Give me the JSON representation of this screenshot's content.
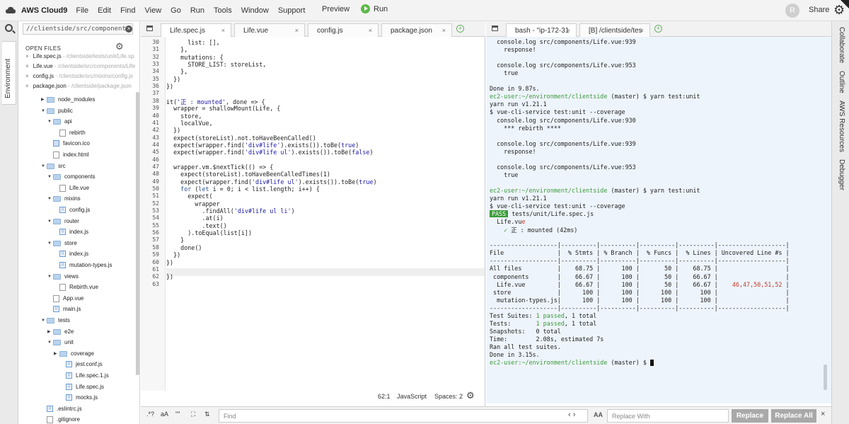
{
  "topbar": {
    "brand": "AWS Cloud9",
    "menus": [
      "File",
      "Edit",
      "Find",
      "View",
      "Go",
      "Run",
      "Tools",
      "Window",
      "Support"
    ],
    "preview_label": "Preview",
    "run_label": "Run",
    "avatar_letter": "R",
    "share_label": "Share"
  },
  "left_rail": {
    "environment_label": "Environment"
  },
  "file_panel": {
    "goto_value": "//clientside/src/components",
    "open_files_title": "OPEN FILES",
    "open_files": [
      {
        "name": "Life.spec.js",
        "path": " - /clientside/tests/unit/Life.sp"
      },
      {
        "name": "Life.vue",
        "path": " - /clientside/src/components/Life"
      },
      {
        "name": "config.js",
        "path": " - /clientside/src/mixins/config.js"
      },
      {
        "name": "package.json",
        "path": " - /clientside/package.json"
      }
    ],
    "tree": [
      {
        "label": "node_modules",
        "type": "folder",
        "arrow": "▶"
      },
      {
        "label": "public",
        "type": "folder",
        "arrow": "▼"
      },
      {
        "label": "api",
        "type": "folder",
        "arrow": "▼"
      },
      {
        "label": "rebirth",
        "type": "file",
        "arrow": ""
      },
      {
        "label": "favicon.ico",
        "type": "img",
        "arrow": ""
      },
      {
        "label": "index.html",
        "type": "file",
        "arrow": ""
      },
      {
        "label": "src",
        "type": "folder",
        "arrow": "▼"
      },
      {
        "label": "components",
        "type": "folder",
        "arrow": "▼"
      },
      {
        "label": "Life.vue",
        "type": "file",
        "arrow": ""
      },
      {
        "label": "mixins",
        "type": "folder",
        "arrow": "▼"
      },
      {
        "label": "config.js",
        "type": "js",
        "arrow": ""
      },
      {
        "label": "router",
        "type": "folder",
        "arrow": "▼"
      },
      {
        "label": "index.js",
        "type": "js",
        "arrow": ""
      },
      {
        "label": "store",
        "type": "folder",
        "arrow": "▼"
      },
      {
        "label": "index.js",
        "type": "js",
        "arrow": ""
      },
      {
        "label": "mutation-types.js",
        "type": "js",
        "arrow": ""
      },
      {
        "label": "views",
        "type": "folder",
        "arrow": "▼"
      },
      {
        "label": "Rebirth.vue",
        "type": "file",
        "arrow": ""
      },
      {
        "label": "App.vue",
        "type": "file",
        "arrow": ""
      },
      {
        "label": "main.js",
        "type": "js",
        "arrow": ""
      },
      {
        "label": "tests",
        "type": "folder",
        "arrow": "▼"
      },
      {
        "label": "e2e",
        "type": "folder",
        "arrow": "▶"
      },
      {
        "label": "unit",
        "type": "folder",
        "arrow": "▼"
      },
      {
        "label": "coverage",
        "type": "folder",
        "arrow": "▶"
      },
      {
        "label": "jest.conf.js",
        "type": "js",
        "arrow": ""
      },
      {
        "label": "Life.spec.1.js",
        "type": "js",
        "arrow": ""
      },
      {
        "label": "Life.spec.js",
        "type": "js",
        "arrow": ""
      },
      {
        "label": "mocks.js",
        "type": "js",
        "arrow": ""
      },
      {
        "label": ".eslintrc.js",
        "type": "js",
        "arrow": ""
      },
      {
        "label": ".gitignore",
        "type": "file",
        "arrow": ""
      }
    ]
  },
  "editor": {
    "tabs": [
      "Life.spec.js",
      "Life.vue",
      "config.js",
      "package.json"
    ],
    "line_numbers": [
      "30",
      "31",
      "32",
      "33",
      "34",
      "35",
      "36",
      "37",
      "38",
      "39",
      "40",
      "41",
      "42",
      "43",
      "44",
      "45",
      "46",
      "47",
      "48",
      "49",
      "50",
      "51",
      "52",
      "53",
      "54",
      "55",
      "56",
      "57",
      "58",
      "59",
      "60",
      "61",
      "62",
      "63"
    ],
    "code_lines": [
      "      list: [],",
      "    },",
      "    mutations: {",
      "      STORE_LIST: storeList,",
      "    },",
      "  })",
      "})",
      "",
      "it('正 : mounted', done => {",
      "  wrapper = shallowMount(Life, {",
      "    store,",
      "    localVue,",
      "  })",
      "  expect(storeList).not.toHaveBeenCalled()",
      "  expect(wrapper.find('div#life').exists()).toBe(true)",
      "  expect(wrapper.find('div#life ul').exists()).toBe(false)",
      "",
      "  wrapper.vm.$nextTick(() => {",
      "    expect(storeList).toHaveBeenCalledTimes(1)",
      "    expect(wrapper.find('div#life ul').exists()).toBe(true)",
      "    for (let i = 0; i < list.length; i++) {",
      "      expect(",
      "        wrapper",
      "          .findAll('div#life ul li')",
      "          .at(i)",
      "          .text()",
      "      ).toEqual(list[i])",
      "    }",
      "    done()",
      "  })",
      "})",
      "",
      "})",
      ""
    ],
    "status": {
      "position": "62:1",
      "language": "JavaScript",
      "spaces": "Spaces: 2"
    }
  },
  "terminal": {
    "tabs": [
      "bash - \"ip-172-31",
      "[B] /clientside/tes"
    ],
    "lines": [
      "  console.log src/components/Life.vue:939",
      "    response!",
      "",
      "  console.log src/components/Life.vue:953",
      "    true",
      "",
      "Done in 9.87s.",
      "ec2-user:~/environment/clientside (master) $ yarn test:unit",
      "yarn run v1.21.1",
      "$ vue-cli-service test:unit --coverage",
      "  console.log src/components/Life.vue:930",
      "    *** rebirth ****",
      "",
      "  console.log src/components/Life.vue:939",
      "    response!",
      "",
      "  console.log src/components/Life.vue:953",
      "    true",
      "",
      "ec2-user:~/environment/clientside (master) $ yarn test:unit",
      "yarn run v1.21.1",
      "$ vue-cli-service test:unit --coverage",
      "PASS| tests/unit/Life.spec.js",
      "  Life.vue",
      "    ✓ 正 : mounted (42ms)",
      "",
      "-------------------|----------|----------|----------|----------|-------------------|",
      "File               |  % Stmts | % Branch |  % Funcs |  % Lines | Uncovered Line #s |",
      "-------------------|----------|----------|----------|----------|-------------------|",
      "All files          |    68.75 |      100 |       50 |    68.75 |                   |",
      " components        |    66.67 |      100 |       50 |    66.67 |                   |",
      "  Life.vue         |    66.67 |      100 |       50 |    66.67 |    46,47,50,51,52 |",
      " store             |      100 |      100 |      100 |      100 |                   |",
      "  mutation-types.js|      100 |      100 |      100 |      100 |                   |",
      "-------------------|----------|----------|----------|----------|-------------------|",
      "Test Suites: 1 passed, 1 total",
      "Tests:       1 passed, 1 total",
      "Snapshots:   0 total",
      "Time:        2.08s, estimated 7s",
      "Ran all test suites.",
      "Done in 3.15s.",
      "ec2-user:~/environment/clientside (master) $ "
    ]
  },
  "findbar": {
    "regex": ".*?",
    "case": "aA",
    "word": "\"\"",
    "find_placeholder": "Find",
    "aa_label": "AA",
    "replace_placeholder": "Replace With",
    "replace_label": "Replace",
    "replace_all_label": "Replace All"
  },
  "right_rail": {
    "items": [
      "Collaborate",
      "Outline",
      "AWS Resources",
      "Debugger"
    ]
  },
  "colors": {
    "pass_green": "#3a9a3a",
    "coverage_yellow": "#b68a0e",
    "uncovered_red": "#c0392b",
    "run_green": "#5eb94a"
  }
}
